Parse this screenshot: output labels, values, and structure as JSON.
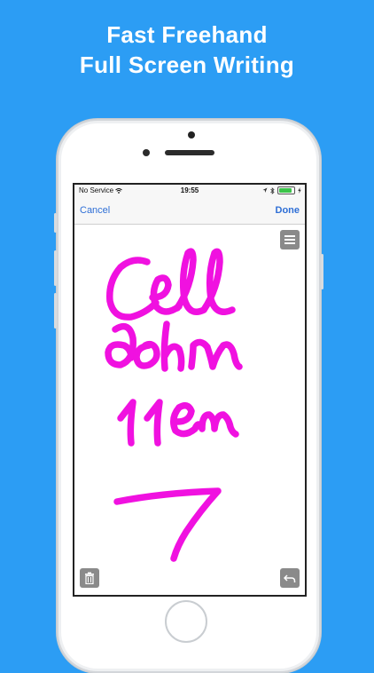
{
  "headline": {
    "line1": "Fast Freehand",
    "line2": "Full Screen Writing"
  },
  "status_bar": {
    "carrier": "No Service",
    "time": "19:55",
    "icons": [
      "wifi-icon",
      "location-icon",
      "bluetooth-icon",
      "battery-icon"
    ]
  },
  "nav": {
    "cancel_label": "Cancel",
    "done_label": "Done"
  },
  "handwriting": {
    "lines": [
      "Cell",
      "John",
      "11 am",
      "arrow"
    ],
    "ink_color": "#f011e0"
  },
  "tools": {
    "menu_icon": "menu-icon",
    "trash_icon": "trash-icon",
    "undo_icon": "undo-icon"
  },
  "colors": {
    "background": "#2c9df4",
    "accent": "#2f6fd6",
    "tool_gray": "#8a8a8a"
  }
}
